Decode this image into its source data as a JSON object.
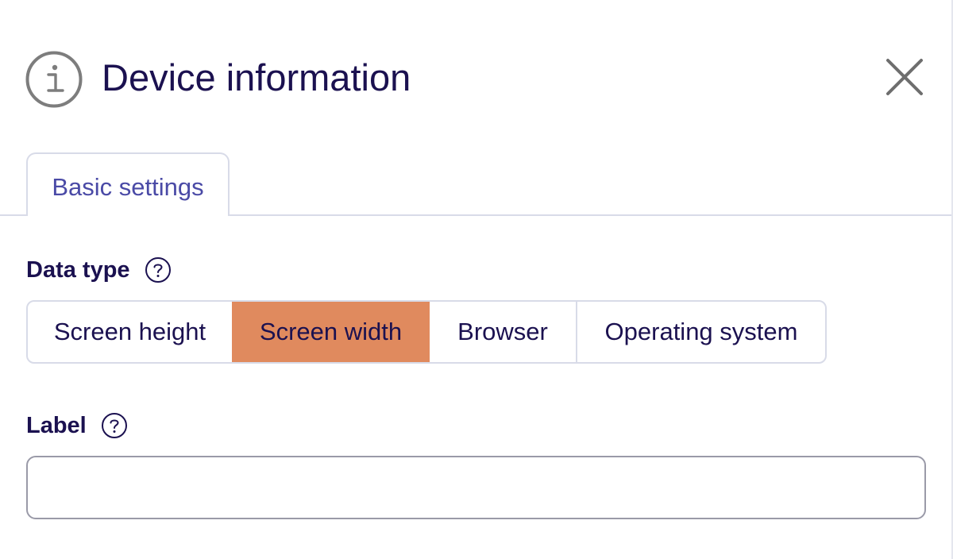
{
  "header": {
    "title": "Device information",
    "icon": "info-icon",
    "close_icon": "close-icon"
  },
  "tabs": [
    {
      "label": "Basic settings",
      "active": true
    }
  ],
  "data_type": {
    "label": "Data type",
    "help_icon": "help-icon",
    "options": [
      {
        "label": "Screen height",
        "selected": false
      },
      {
        "label": "Screen width",
        "selected": true
      },
      {
        "label": "Browser",
        "selected": false
      },
      {
        "label": "Operating system",
        "selected": false
      }
    ]
  },
  "label_field": {
    "label": "Label",
    "help_icon": "help-icon",
    "value": "",
    "placeholder": ""
  },
  "colors": {
    "text_primary": "#1b1150",
    "tab_text": "#4a4aa6",
    "accent_selected": "#e08a5e",
    "border": "#d8dbe8",
    "icon_gray": "#7d7d7d"
  }
}
